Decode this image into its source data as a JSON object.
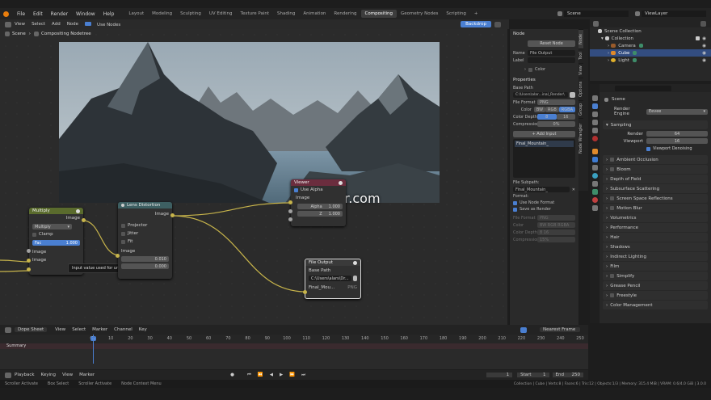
{
  "menu": [
    "File",
    "Edit",
    "Render",
    "Window",
    "Help"
  ],
  "workspaces": [
    "Layout",
    "Modeling",
    "Sculpting",
    "UV Editing",
    "Texture Paint",
    "Shading",
    "Animation",
    "Rendering",
    "Compositing",
    "Geometry Nodes",
    "Scripting",
    "+"
  ],
  "active_workspace": "Compositing",
  "scene_name": "Scene",
  "view_layer": "ViewLayer",
  "node_header": [
    "View",
    "Select",
    "Add",
    "Node",
    "Use Nodes"
  ],
  "backdrop_label": "Backdrop",
  "breadcrumb": {
    "scene": "Scene",
    "tree": "Compositing Nodetree"
  },
  "watermark": "Cger.com",
  "nodes": {
    "multiply": {
      "title": "Multiply",
      "out": "Image",
      "mode": "Multiply",
      "clamp": "Clamp",
      "fac_label": "Fac",
      "fac_value": "1.000",
      "in1": "Image",
      "in2": "Image"
    },
    "lens": {
      "title": "Lens Distortion",
      "out": "Image",
      "projector": "Projector",
      "jitter": "Jitter",
      "fit": "Fit",
      "in": "Image",
      "v1": "0.010",
      "v2": "0.000"
    },
    "viewer": {
      "title": "Viewer",
      "use_alpha": "Use Alpha",
      "in": "Image",
      "alpha_label": "Alpha",
      "alpha_value": "1.000",
      "z_label": "Z",
      "z_value": "1.000"
    },
    "fileout": {
      "title": "File Output",
      "base_path": "Base Path",
      "path": "C:\\Users\\alars\\Dr...",
      "in": "Final_Mou...",
      "fmt": "PNG"
    }
  },
  "tooltip": "Input value used for unconnected socket.",
  "sidebar": {
    "node_header": "Node",
    "name_label": "Name",
    "name_value": "File Output",
    "label_label": "Label",
    "reset": "Reset Node",
    "color": "Color",
    "properties": "Properties",
    "base_path_label": "Base Path",
    "base_path": "C:\\Users\\alar...inal_Render\\",
    "file_format_label": "File Format",
    "file_format": "PNG",
    "color_label": "Color",
    "color_opts": [
      "BW",
      "RGB",
      "RGBA"
    ],
    "depth_label": "Color Depth",
    "depth_opts": [
      "8",
      "16"
    ],
    "compression_label": "Compression",
    "compression": "0%",
    "add_input": "Add Input",
    "input_item": "Final_Mountain_",
    "subpath_label": "File Subpath:",
    "subpath": "Final_Mountain_",
    "format_label": "Format:",
    "use_node_format": "Use Node Format",
    "save_as_render": "Save as Render",
    "dim_labels": [
      "File Format",
      "Color",
      "Color Depth",
      "Compression"
    ],
    "dim_values": [
      "PNG",
      "BW RGB RGBA",
      "8 16",
      "15%"
    ]
  },
  "side_tabs": [
    "Node",
    "Tool",
    "View",
    "Options",
    "Group",
    "Node Wrangler"
  ],
  "outliner": {
    "root": "Scene Collection",
    "collection": "Collection",
    "items": [
      {
        "name": "Camera",
        "color": "#9a5b2b"
      },
      {
        "name": "Cube",
        "color": "#e08a2b"
      },
      {
        "name": "Light",
        "color": "#e0b02b"
      }
    ]
  },
  "props": {
    "scene": "Scene",
    "engine_label": "Render Engine",
    "engine": "Eevee",
    "sampling": "Sampling",
    "render_label": "Render",
    "render_value": "64",
    "viewport_label": "Viewport",
    "viewport_value": "16",
    "denoise": "Viewport Denoising",
    "panels": [
      "Ambient Occlusion",
      "Bloom",
      "Depth of Field",
      "Subsurface Scattering",
      "Screen Space Reflections",
      "Motion Blur",
      "Volumetrics",
      "Performance",
      "Hair",
      "Shadows",
      "Indirect Lighting",
      "Film",
      "Simplify",
      "Grease Pencil",
      "Freestyle",
      "Color Management"
    ]
  },
  "dope": {
    "mode": "Dope Sheet",
    "menu": [
      "View",
      "Select",
      "Marker",
      "Channel",
      "Key"
    ],
    "snap": "Nearest Frame",
    "summary": "Summary",
    "ticks": [
      "0",
      "10",
      "20",
      "30",
      "40",
      "50",
      "60",
      "70",
      "80",
      "90",
      "100",
      "110",
      "120",
      "130",
      "140",
      "150",
      "160",
      "170",
      "180",
      "190",
      "200",
      "210",
      "220",
      "230",
      "240",
      "250"
    ],
    "current": "1"
  },
  "timeline": {
    "menu": [
      "Playback",
      "Keying",
      "View",
      "Marker"
    ],
    "frame": "1",
    "start_label": "Start",
    "start": "1",
    "end_label": "End",
    "end": "250"
  },
  "status": {
    "left": [
      "Scroller Activate",
      "Box Select",
      "Scroller Activate",
      "Node Context Menu"
    ],
    "right": "Collection | Cube | Verts:8 | Faces:6 | Tris:12 | Objects:1/3 | Memory: 315.4 MiB | VRAM: 0.6/4.0 GiB | 3.0.0"
  }
}
